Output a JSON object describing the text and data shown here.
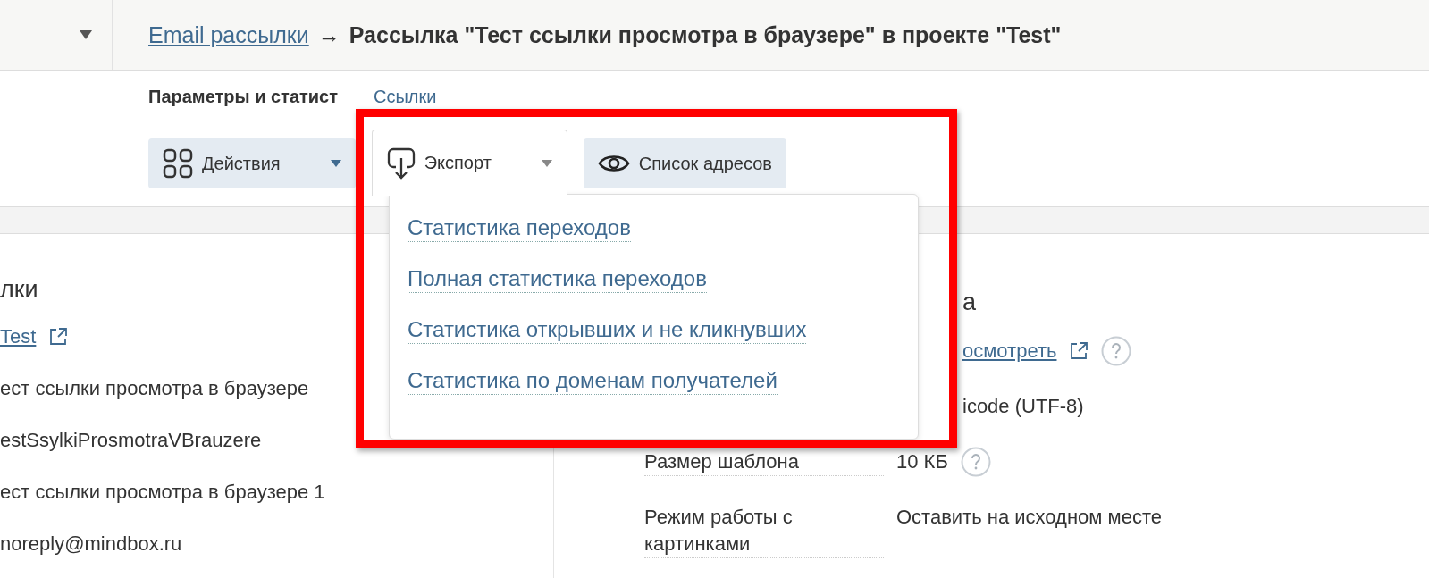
{
  "header": {
    "breadcrumb_link": "Email рассылки",
    "separator": "→",
    "current": "Рассылка \"Тест ссылки просмотра в браузере\" в проекте \"Test\""
  },
  "tabs": [
    {
      "label": "Параметры и статист",
      "selected": true
    },
    {
      "label": "Ссылки",
      "selected": false
    }
  ],
  "toolbar": [
    {
      "label": "Действия",
      "kind": "actions",
      "expanded": false
    },
    {
      "label": "Экспорт",
      "kind": "export",
      "expanded": true
    },
    {
      "label": "Список адресов",
      "kind": "view",
      "expanded": false
    }
  ],
  "export_menu": {
    "items": [
      "Статистика переходов",
      "Полная статистика переходов",
      "Статистика открывших и не кликнувших",
      "Статистика по доменам получателей"
    ]
  },
  "left_panel": {
    "title": "лки",
    "rows": [
      {
        "kind": "link",
        "value": "Test"
      },
      {
        "kind": "text",
        "value": "ест ссылки просмотра в браузере"
      },
      {
        "kind": "text",
        "value": "estSsylkiProsmotraVBrauzere"
      },
      {
        "kind": "text",
        "value": "ест ссылки просмотра в браузере 1"
      },
      {
        "kind": "text",
        "value": "noreply@mindbox.ru"
      }
    ]
  },
  "right_panel": {
    "title": "а",
    "rows": [
      {
        "kind": "link",
        "value": "осмотреть",
        "help": true
      },
      {
        "kind": "text",
        "value": "icode (UTF-8)",
        "help": false
      },
      {
        "kind": "labeled",
        "label": "Размер шаблона",
        "value": "10 КБ",
        "help": true
      },
      {
        "kind": "labeled",
        "label": "Режим работы с картинками",
        "value": "Оставить на исходном месте",
        "help": false
      }
    ]
  }
}
